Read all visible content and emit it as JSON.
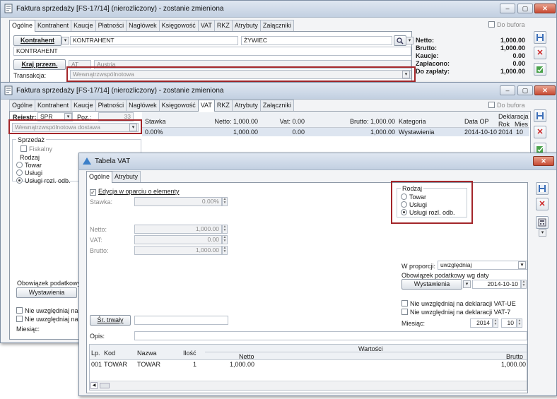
{
  "colors": {
    "accent_red": "#a3262a",
    "title_bar": "#c2d0e1"
  },
  "window_controls": {
    "minimize": "–",
    "maximize": "▢",
    "close": "✕"
  },
  "win1": {
    "title": "Faktura sprzedaży [FS-17/14] (nierozliczony) - zostanie zmieniona",
    "do_bufora": "Do bufora",
    "tabs": [
      "Ogólne",
      "Kontrahent",
      "Kaucje",
      "Płatności",
      "Nagłówek",
      "Księgowość",
      "VAT",
      "RKZ",
      "Atrybuty",
      "Załączniki"
    ],
    "kontrahent_button": "Kontrahent",
    "kontrahent_value": "KONTRAHENT",
    "city_value": "ŻYWIEC",
    "kontrahent_line2": "KONTRAHENT",
    "kraj_button": "Kraj przezn.",
    "kraj_code": "AT",
    "kraj_name": "Austria",
    "transakcja_label": "Transakcja:",
    "transakcja_value": "Wewnątrzwspólnotowa",
    "totals": [
      {
        "label": "Netto:",
        "value": "1,000.00"
      },
      {
        "label": "Brutto:",
        "value": "1,000.00"
      },
      {
        "label": "Kaucje:",
        "value": "0.00"
      },
      {
        "label": "Zapłacono:",
        "value": "0.00"
      },
      {
        "label": "Do zapłaty:",
        "value": "1,000.00"
      }
    ]
  },
  "win2": {
    "title": "Faktura sprzedaży [FS-17/14] (nierozliczony) - zostanie zmieniona",
    "do_bufora": "Do bufora",
    "tabs": [
      "Ogólne",
      "Kontrahent",
      "Kaucje",
      "Płatności",
      "Nagłówek",
      "Księgowość",
      "VAT",
      "RKZ",
      "Atrybuty",
      "Załączniki"
    ],
    "rejestr_label": "Rejestr:",
    "rejestr_value": "SPR",
    "poz_label": "Poz.:",
    "poz_value": "33",
    "dostawa_value": "Wewnątrzwspólnotowa dostawa",
    "sprzedaz_label": "Sprzedaż",
    "fiskalny_label": "Fiskalny",
    "rodzaj_label": "Rodzaj",
    "rodzaj_options": [
      "Towar",
      "Usługi",
      "Usługi rozl. odb."
    ],
    "obowiazek_label": "Obowiązek podatkowy",
    "wystawienia_button": "Wystawienia",
    "nie_uwzgl_1": "Nie uwzględniaj na d",
    "nie_uwzgl_2": "Nie uwzględniaj na d",
    "miesiac_label": "Miesiąc:",
    "grid_headers": {
      "stawka": "Stawka",
      "netto": "Netto: 1,000.00",
      "vat": "Vat: 0.00",
      "brutto": "Brutto: 1,000.00",
      "kategoria": "Kategoria",
      "data_op": "Data OP",
      "deklaracja": "Deklaracja",
      "rok": "Rok",
      "mies": "Mies"
    },
    "grid_row": {
      "stawka": "0.00%",
      "netto": "1,000.00",
      "vat": "0.00",
      "brutto": "1,000.00",
      "kategoria": "Wystawienia",
      "data_op": "2014-10-10",
      "rok": "2014",
      "mies": "10"
    }
  },
  "win3": {
    "title": "Tabela VAT",
    "tabs": [
      "Ogólne",
      "Atrybuty"
    ],
    "edycja_label": "Edycja w oparciu o elementy",
    "stawka_label": "Stawka:",
    "stawka_value": "0.00%",
    "netto_label": "Netto:",
    "netto_value": "1,000.00",
    "vat_label": "VAT:",
    "vat_value": "0.00",
    "brutto_label": "Brutto:",
    "brutto_value": "1,000.00",
    "rodzaj_label": "Rodzaj",
    "rodzaj_options": [
      "Towar",
      "Usługi",
      "Usługi rozl. odb."
    ],
    "w_proporcji_label": "W proporcji:",
    "w_proporcji_value": "uwzględniaj",
    "obowiazek_label": "Obowiązek podatkowy wg daty",
    "wystawienia_button": "Wystawienia",
    "data_value": "2014-10-10",
    "nie_uwzgl_ue": "Nie uwzględniaj na deklaracji VAT-UE",
    "nie_uwzgl_7": "Nie uwzględniaj na deklaracji VAT-7",
    "miesiac_label": "Miesiąc:",
    "rok_value": "2014",
    "mies_value": "10",
    "sr_trwaly_button": "Śr. trwały",
    "opis_label": "Opis:",
    "table": {
      "wartosci": "Wartości",
      "headers": [
        "Lp.",
        "Kod",
        "Nazwa",
        "Ilość",
        "Netto",
        "Brutto"
      ],
      "rows": [
        {
          "lp": "001",
          "kod": "TOWAR",
          "nazwa": "TOWAR",
          "ilosc": "1",
          "netto": "1,000.00",
          "brutto": "1,000.00"
        }
      ]
    }
  }
}
